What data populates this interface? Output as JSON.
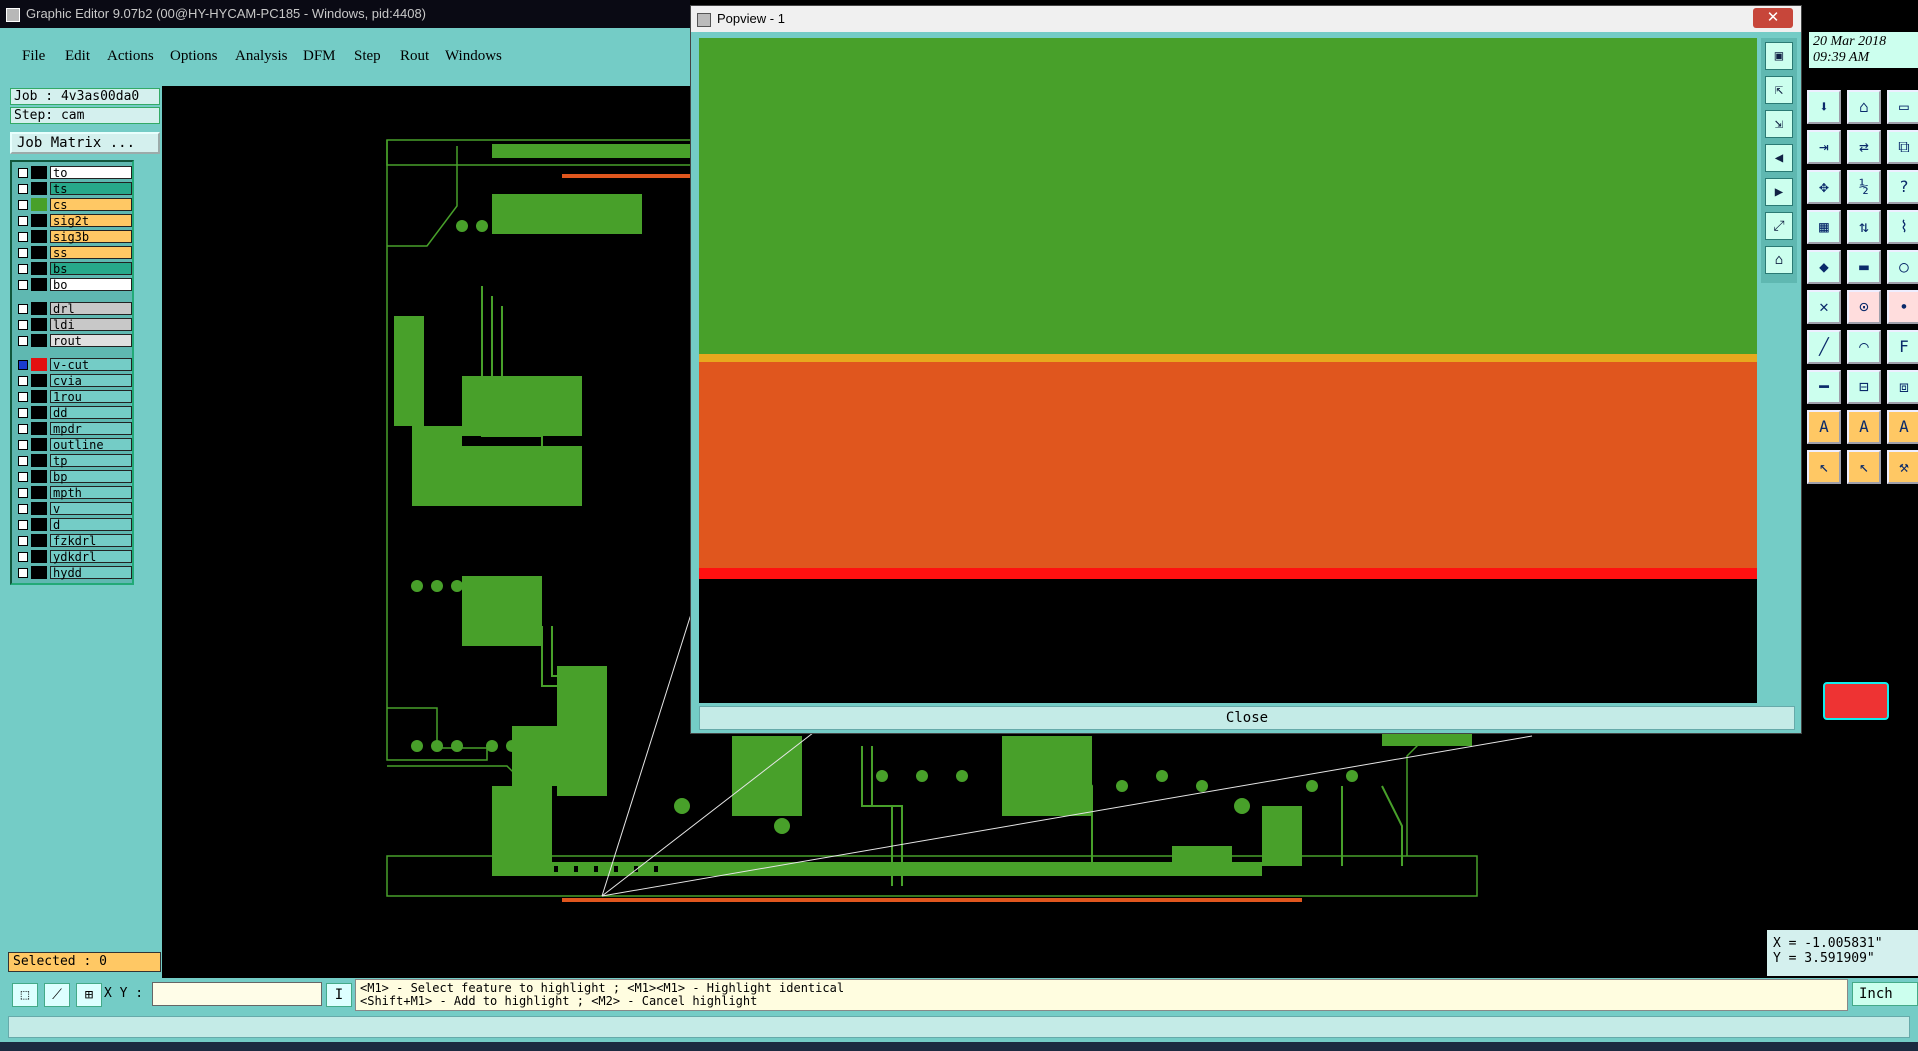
{
  "window": {
    "title": "Graphic Editor 9.07b2 (00@HY-HYCAM-PC185 - Windows, pid:4408)"
  },
  "menu": {
    "items": [
      "File",
      "Edit",
      "Actions",
      "Options",
      "Analysis",
      "DFM",
      "Step",
      "Rout",
      "Windows"
    ],
    "underline_first": [
      "F",
      "E",
      "A",
      "O",
      "A",
      "D",
      "S",
      "R",
      "W"
    ]
  },
  "job": {
    "job_line": "Job : 4v3as00da0",
    "step_line": "Step: cam",
    "matrix_button": "Job Matrix ..."
  },
  "layers": [
    {
      "name": "to",
      "color": "#ffffff",
      "swatch": "#000000"
    },
    {
      "name": "ts",
      "color": "#27a88a",
      "swatch": "#000000"
    },
    {
      "name": "cs",
      "color": "#ffc864",
      "swatch": "#48a02a"
    },
    {
      "name": "sig2t",
      "color": "#ffc864",
      "swatch": "#000000"
    },
    {
      "name": "sig3b",
      "color": "#ffc864",
      "swatch": "#000000"
    },
    {
      "name": "ss",
      "color": "#ffc864",
      "swatch": "#000000"
    },
    {
      "name": "bs",
      "color": "#27a88a",
      "swatch": "#000000"
    },
    {
      "name": "bo",
      "color": "#ffffff",
      "swatch": "#000000"
    },
    {
      "name": "drl",
      "color": "#c8c8c8",
      "swatch": "#000000"
    },
    {
      "name": "ldi",
      "color": "#c8c8c8",
      "swatch": "#000000"
    },
    {
      "name": "rout",
      "color": "#e0e0e0",
      "swatch": "#000000"
    },
    {
      "name": "v-cut",
      "color": "#74ccc6",
      "swatch": "#e31010"
    },
    {
      "name": "cvia",
      "color": "#74ccc6",
      "swatch": "#000000"
    },
    {
      "name": "1rou",
      "color": "#74ccc6",
      "swatch": "#000000"
    },
    {
      "name": "dd",
      "color": "#74ccc6",
      "swatch": "#000000"
    },
    {
      "name": "mpdr",
      "color": "#74ccc6",
      "swatch": "#000000"
    },
    {
      "name": "outline",
      "color": "#74ccc6",
      "swatch": "#000000"
    },
    {
      "name": "tp",
      "color": "#74ccc6",
      "swatch": "#000000"
    },
    {
      "name": "bp",
      "color": "#74ccc6",
      "swatch": "#000000"
    },
    {
      "name": "mpth",
      "color": "#74ccc6",
      "swatch": "#000000"
    },
    {
      "name": "v",
      "color": "#74ccc6",
      "swatch": "#000000"
    },
    {
      "name": "d",
      "color": "#74ccc6",
      "swatch": "#000000"
    },
    {
      "name": "fzkdrl",
      "color": "#74ccc6",
      "swatch": "#000000"
    },
    {
      "name": "ydkdrl",
      "color": "#74ccc6",
      "swatch": "#000000"
    },
    {
      "name": "hydd",
      "color": "#74ccc6",
      "swatch": "#000000"
    }
  ],
  "status": {
    "selected": "Selected : 0",
    "xy_label": "X Y :",
    "xy_value": "",
    "hint_line1": "<M1> - Select feature to highlight ; <M1><M1> - Highlight identical",
    "hint_line2": "<Shift+M1> - Add to highlight ; <M2> - Cancel highlight",
    "units": "Inch",
    "x_coord": "X = -1.005831\"",
    "y_coord": "Y = 3.591909\""
  },
  "clock": {
    "date": "20 Mar 2018",
    "time": "09:39 AM"
  },
  "popview": {
    "title": "Popview - 1",
    "close_label": "Close",
    "close_x": "✕"
  },
  "colors": {
    "panel": "#74ccc6",
    "board_green": "#48a02a",
    "copper_orange": "#e0561e",
    "vcut_red": "#ff1010"
  },
  "icons": {
    "popview_side": [
      "window-icon",
      "zoom-in-icon",
      "zoom-out-icon",
      "pan-left-icon",
      "pan-right-icon",
      "fit-icon",
      "home-icon"
    ],
    "right_tools": [
      "select-icon",
      "home-icon",
      "frame-icon",
      "move-icon",
      "swap-icon",
      "copy-icon",
      "zoom-icon",
      "scale-icon",
      "help-icon",
      "grid-icon",
      "measure-icon",
      "route-icon",
      "draw-icon",
      "line-icon",
      "circle-icon",
      "cross-icon",
      "snap-icon",
      "node-icon",
      "pen-icon",
      "arc-icon",
      "text-icon",
      "dash-icon",
      "ruler-icon",
      "group-icon",
      "font-a-icon",
      "font-b-icon",
      "font-c-icon",
      "pointer-icon",
      "pointer2-icon",
      "tool-icon"
    ]
  }
}
